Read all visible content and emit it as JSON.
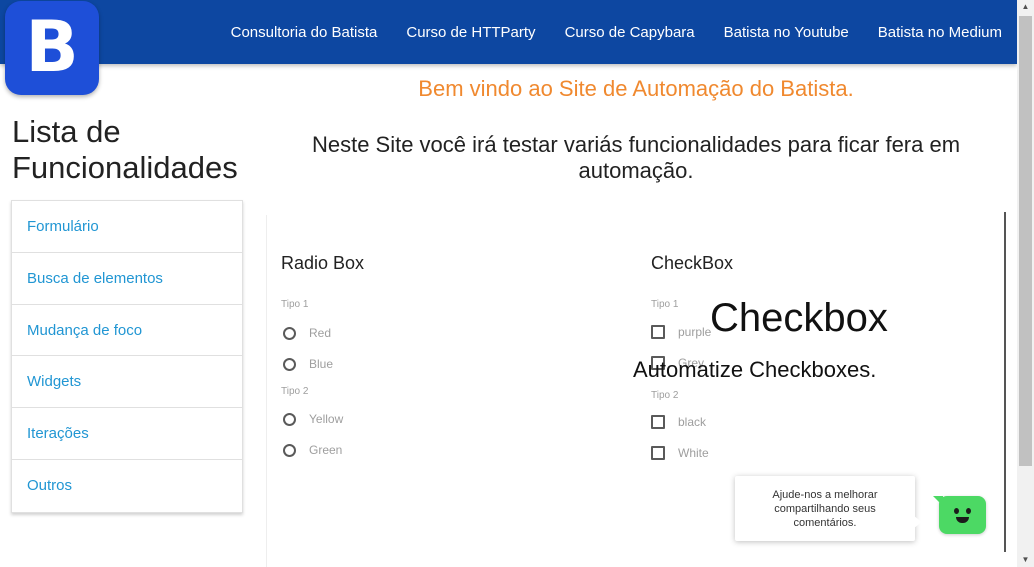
{
  "header": {
    "logo_letter": "B",
    "nav": [
      "Consultoria do Batista",
      "Curso de HTTParty",
      "Curso de Capybara",
      "Batista no Youtube",
      "Batista no Medium"
    ]
  },
  "welcome": "Bem vindo ao Site de Automação do Batista.",
  "intro": "Neste Site você irá testar variás funcionalidades para ficar fera em automação.",
  "sidebar": {
    "title": "Lista de Funcionalidades",
    "items": [
      "Formulário",
      "Busca de elementos",
      "Mudança de foco",
      "Widgets",
      "Iterações",
      "Outros"
    ]
  },
  "radio_section": {
    "title": "Radio Box",
    "group1_label": "Tipo 1",
    "group1": [
      "Red",
      "Blue"
    ],
    "group2_label": "Tipo 2",
    "group2": [
      "Yellow",
      "Green"
    ]
  },
  "checkbox_section": {
    "title": "CheckBox",
    "group1_label": "Tipo 1",
    "group1": [
      "purple",
      "Grey"
    ],
    "group2_label": "Tipo 2",
    "group2": [
      "black",
      "White"
    ]
  },
  "overlay": {
    "heading": "Checkbox",
    "subheading": "Automatize Checkboxes."
  },
  "feedback": {
    "text": "Ajude-nos a melhorar compartilhando seus comentários."
  },
  "colors": {
    "navbar": "#0d47a1",
    "logo": "#1e4fd8",
    "welcome": "#f0892f",
    "menu_link": "#2196d3",
    "feedback_button": "#4cd964"
  }
}
